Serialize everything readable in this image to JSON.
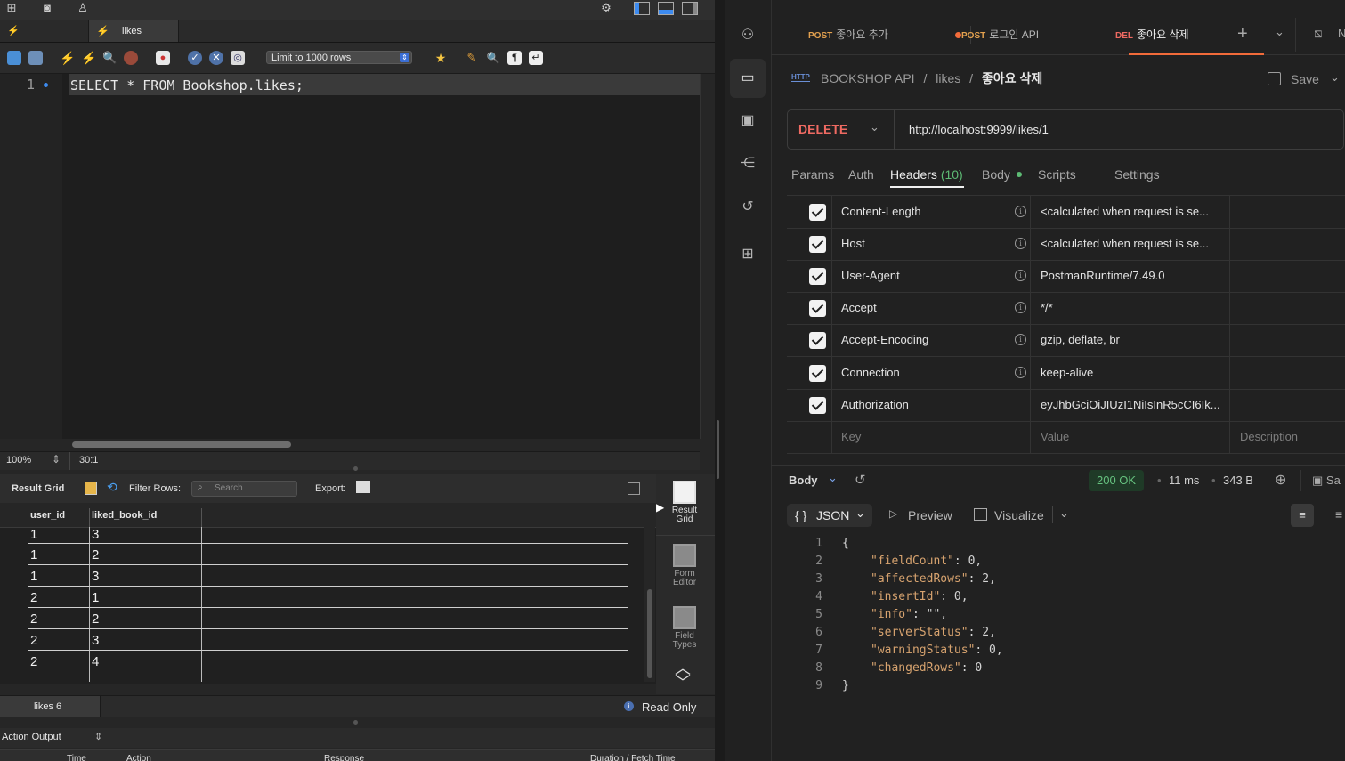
{
  "workbench": {
    "query_tab_label": "likes",
    "limit_select": "Limit to 1000 rows",
    "editor": {
      "line_number": "1",
      "sql": "SELECT * FROM Bookshop.likes;"
    },
    "status": {
      "zoom": "100%",
      "cursor_pos": "30:1"
    },
    "result_bar": {
      "result_grid_label": "Result Grid",
      "filter_rows_label": "Filter Rows:",
      "search_placeholder": "Search",
      "export_label": "Export:"
    },
    "grid": {
      "columns": [
        "user_id",
        "liked_book_id"
      ],
      "rows": [
        [
          "1",
          "3"
        ],
        [
          "1",
          "2"
        ],
        [
          "1",
          "3"
        ],
        [
          "2",
          "1"
        ],
        [
          "2",
          "2"
        ],
        [
          "2",
          "3"
        ],
        [
          "2",
          "4"
        ]
      ]
    },
    "side_panel": {
      "result_grid": "Result Grid",
      "form_editor": "Form Editor",
      "field_types": "Field Types"
    },
    "result_tab_label": "likes 6",
    "read_only_label": "Read Only",
    "action_output_label": "Action Output",
    "action_columns": [
      "Time",
      "Action",
      "Response",
      "Duration / Fetch Time"
    ]
  },
  "postman": {
    "tabs": [
      {
        "method": "POST",
        "label": "좋아요 추가",
        "unsaved": true
      },
      {
        "method": "POST",
        "label": "로그인 API",
        "unsaved": false
      },
      {
        "method": "DEL",
        "label": "좋아요 삭제",
        "unsaved": false
      }
    ],
    "breadcrumb": {
      "badge": "HTTP",
      "collection": "BOOKSHOP API",
      "folder": "likes",
      "request": "좋아요 삭제"
    },
    "save_label": "Save",
    "request": {
      "method": "DELETE",
      "url": "http://localhost:9999/likes/1"
    },
    "request_tabs": [
      {
        "label": "Params"
      },
      {
        "label": "Auth"
      },
      {
        "label": "Headers",
        "count": "(10)"
      },
      {
        "label": "Body"
      },
      {
        "label": "Scripts"
      },
      {
        "label": "Settings"
      }
    ],
    "headers": [
      {
        "key": "Content-Length",
        "value": "<calculated when request is se..."
      },
      {
        "key": "Host",
        "value": "<calculated when request is se..."
      },
      {
        "key": "User-Agent",
        "value": "PostmanRuntime/7.49.0"
      },
      {
        "key": "Accept",
        "value": "*/*"
      },
      {
        "key": "Accept-Encoding",
        "value": "gzip, deflate, br"
      },
      {
        "key": "Connection",
        "value": "keep-alive"
      },
      {
        "key": "Authorization",
        "value": "eyJhbGciOiJIUzI1NiIsInR5cCI6Ik..."
      }
    ],
    "header_placeholders": {
      "key": "Key",
      "value": "Value",
      "description": "Description"
    },
    "response": {
      "body_label": "Body",
      "status": "200 OK",
      "time": "11 ms",
      "size": "343 B",
      "format": "JSON",
      "preview_label": "Preview",
      "visualize_label": "Visualize",
      "lines": [
        {
          "n": "1",
          "text": "{"
        },
        {
          "n": "2",
          "key": "\"fieldCount\"",
          "val": " 0,"
        },
        {
          "n": "3",
          "key": "\"affectedRows\"",
          "val": " 2,"
        },
        {
          "n": "4",
          "key": "\"insertId\"",
          "val": " 0,"
        },
        {
          "n": "5",
          "key": "\"info\"",
          "val": " \"\","
        },
        {
          "n": "6",
          "key": "\"serverStatus\"",
          "val": " 2,"
        },
        {
          "n": "7",
          "key": "\"warningStatus\"",
          "val": " 0,"
        },
        {
          "n": "8",
          "key": "\"changedRows\"",
          "val": " 0"
        },
        {
          "n": "9",
          "text": "}"
        }
      ]
    }
  }
}
